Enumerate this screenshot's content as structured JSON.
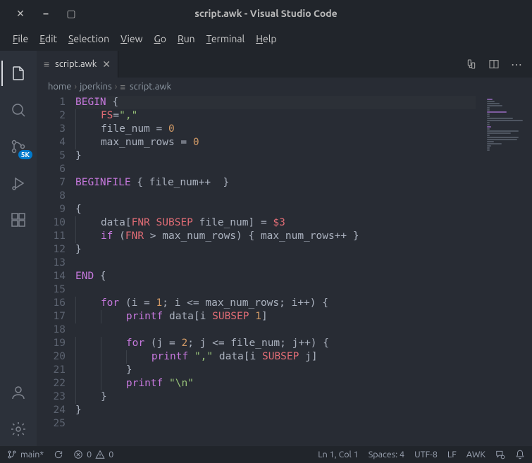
{
  "window": {
    "title": "script.awk - Visual Studio Code"
  },
  "menu": [
    "File",
    "Edit",
    "Selection",
    "View",
    "Go",
    "Run",
    "Terminal",
    "Help"
  ],
  "activity": {
    "source_control_badge": "5K"
  },
  "tab": {
    "filename": "script.awk"
  },
  "breadcrumbs": [
    "home",
    "jperkins",
    "script.awk"
  ],
  "code": {
    "lines": [
      [
        [
          "kw",
          "BEGIN"
        ],
        [
          "pln",
          " {"
        ]
      ],
      [
        [
          "pln",
          "    "
        ],
        [
          "var",
          "FS"
        ],
        [
          "pln",
          "="
        ],
        [
          "str",
          "\",\""
        ]
      ],
      [
        [
          "pln",
          "    file_num = "
        ],
        [
          "num",
          "0"
        ]
      ],
      [
        [
          "pln",
          "    max_num_rows = "
        ],
        [
          "num",
          "0"
        ]
      ],
      [
        [
          "pln",
          "}"
        ]
      ],
      [
        [
          "pln",
          ""
        ]
      ],
      [
        [
          "kw",
          "BEGINFILE"
        ],
        [
          "pln",
          " { file_num++  }"
        ]
      ],
      [
        [
          "pln",
          ""
        ]
      ],
      [
        [
          "pln",
          "{"
        ]
      ],
      [
        [
          "pln",
          "    data["
        ],
        [
          "var",
          "FNR"
        ],
        [
          "pln",
          " "
        ],
        [
          "var",
          "SUBSEP"
        ],
        [
          "pln",
          " file_num] = "
        ],
        [
          "var",
          "$3"
        ]
      ],
      [
        [
          "pln",
          "    "
        ],
        [
          "kw",
          "if"
        ],
        [
          "pln",
          " ("
        ],
        [
          "var",
          "FNR"
        ],
        [
          "pln",
          " > max_num_rows) { max_num_rows++ }"
        ]
      ],
      [
        [
          "pln",
          "}"
        ]
      ],
      [
        [
          "pln",
          ""
        ]
      ],
      [
        [
          "kw",
          "END"
        ],
        [
          "pln",
          " {"
        ]
      ],
      [
        [
          "pln",
          ""
        ]
      ],
      [
        [
          "pln",
          "    "
        ],
        [
          "kw",
          "for"
        ],
        [
          "pln",
          " (i = "
        ],
        [
          "num",
          "1"
        ],
        [
          "pln",
          "; i <= max_num_rows; i++) {"
        ]
      ],
      [
        [
          "pln",
          "        "
        ],
        [
          "kw",
          "printf"
        ],
        [
          "pln",
          " data[i "
        ],
        [
          "var",
          "SUBSEP"
        ],
        [
          "pln",
          " "
        ],
        [
          "num",
          "1"
        ],
        [
          "pln",
          "]"
        ]
      ],
      [
        [
          "pln",
          ""
        ]
      ],
      [
        [
          "pln",
          "        "
        ],
        [
          "kw",
          "for"
        ],
        [
          "pln",
          " (j = "
        ],
        [
          "num",
          "2"
        ],
        [
          "pln",
          "; j <= file_num; j++) {"
        ]
      ],
      [
        [
          "pln",
          "            "
        ],
        [
          "kw",
          "printf"
        ],
        [
          "pln",
          " "
        ],
        [
          "str",
          "\",\""
        ],
        [
          "pln",
          " data[i "
        ],
        [
          "var",
          "SUBSEP"
        ],
        [
          "pln",
          " j]"
        ]
      ],
      [
        [
          "pln",
          "        }"
        ]
      ],
      [
        [
          "pln",
          "        "
        ],
        [
          "kw",
          "printf"
        ],
        [
          "pln",
          " "
        ],
        [
          "str",
          "\"\\n\""
        ]
      ],
      [
        [
          "pln",
          "    }"
        ]
      ],
      [
        [
          "pln",
          "}"
        ]
      ],
      [
        [
          "pln",
          ""
        ]
      ]
    ]
  },
  "status": {
    "branch": "main*",
    "errors": "0",
    "warnings": "0",
    "position": "Ln 1, Col 1",
    "spaces": "Spaces: 4",
    "encoding": "UTF-8",
    "eol": "LF",
    "language": "AWK"
  }
}
